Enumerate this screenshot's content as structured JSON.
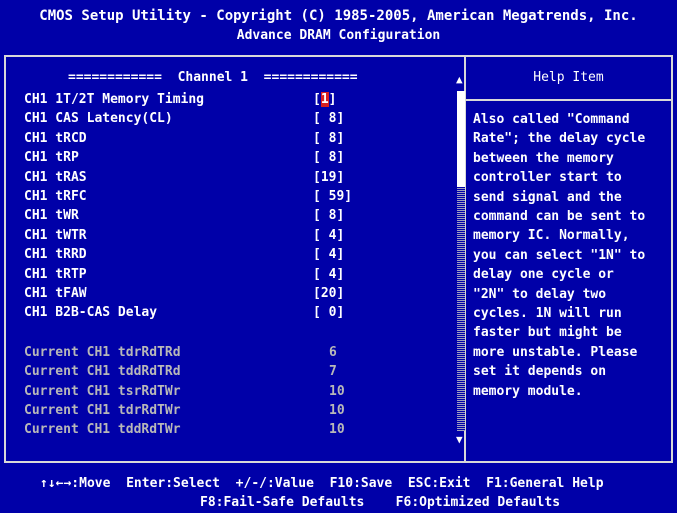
{
  "header": {
    "title": "CMOS Setup Utility - Copyright (C) 1985-2005, American Megatrends, Inc.",
    "subtitle": "Advance DRAM Configuration"
  },
  "channel_heading": "============  Channel 1  ============",
  "settings": [
    {
      "label": "CH1 1T/2T Memory Timing",
      "value": "[1]",
      "selected": true
    },
    {
      "label": "CH1 CAS Latency(CL)",
      "value": "[ 8]"
    },
    {
      "label": "CH1 tRCD",
      "value": "[ 8]"
    },
    {
      "label": "CH1 tRP",
      "value": "[ 8]"
    },
    {
      "label": "CH1 tRAS",
      "value": "[19]"
    },
    {
      "label": "CH1 tRFC",
      "value": "[ 59]"
    },
    {
      "label": "CH1 tWR",
      "value": "[ 8]"
    },
    {
      "label": "CH1 tWTR",
      "value": "[ 4]"
    },
    {
      "label": "CH1 tRRD",
      "value": "[ 4]"
    },
    {
      "label": "CH1 tRTP",
      "value": "[ 4]"
    },
    {
      "label": "CH1 tFAW",
      "value": "[20]"
    },
    {
      "label": "CH1 B2B-CAS Delay",
      "value": "[ 0]"
    }
  ],
  "readonly": [
    {
      "label": "Current CH1 tdrRdTRd",
      "value": "6"
    },
    {
      "label": "Current CH1 tddRdTRd",
      "value": "7"
    },
    {
      "label": "Current CH1 tsrRdTWr",
      "value": "10"
    },
    {
      "label": "Current CH1 tdrRdTWr",
      "value": "10"
    },
    {
      "label": "Current CH1 tddRdTWr",
      "value": "10"
    }
  ],
  "help": {
    "title": "Help Item",
    "text": "Also called \"Command\nRate\"; the delay cycle\nbetween the memory\ncontroller start to\nsend signal and the\ncommand can be sent to\nmemory IC. Normally,\nyou can select \"1N\" to\ndelay one cycle or\n\"2N\" to delay two\ncycles. 1N will run\nfaster but might be\nmore unstable. Please\nset it depends on\nmemory module."
  },
  "footer": {
    "line1": "↑↓←→:Move  Enter:Select  +/-/:Value  F10:Save  ESC:Exit  F1:General Help",
    "line2": "F8:Fail-Safe Defaults    F6:Optimized Defaults"
  },
  "scrollbar": {
    "up_icon": "▲",
    "down_icon": "▼",
    "position": 0.0
  },
  "colors": {
    "background": "#0000a8",
    "text": "#ffffff",
    "dim_text": "#b8b8b8",
    "cursor": "#d82020"
  }
}
